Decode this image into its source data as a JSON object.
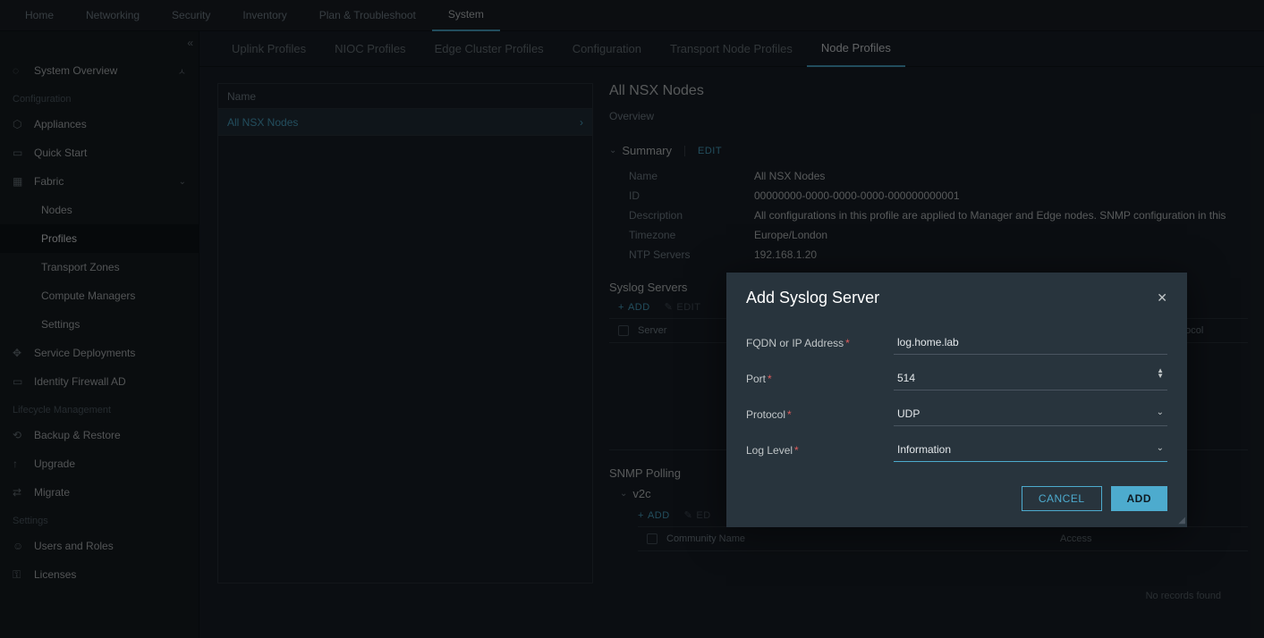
{
  "topnav": {
    "items": [
      "Home",
      "Networking",
      "Security",
      "Inventory",
      "Plan & Troubleshoot",
      "System"
    ],
    "active": 5
  },
  "sidebar": {
    "overview_label": "System Overview",
    "groups": {
      "configuration": "Configuration",
      "lifecycle": "Lifecycle Management",
      "settings": "Settings"
    },
    "items": {
      "appliances": "Appliances",
      "quickstart": "Quick Start",
      "fabric": "Fabric",
      "nodes": "Nodes",
      "profiles": "Profiles",
      "tzones": "Transport Zones",
      "cmanagers": "Compute Managers",
      "fsettings": "Settings",
      "svcdeploy": "Service Deployments",
      "idfirewall": "Identity Firewall AD",
      "backup": "Backup & Restore",
      "upgrade": "Upgrade",
      "migrate": "Migrate",
      "usersroles": "Users and Roles",
      "licenses": "Licenses"
    }
  },
  "subtabs": {
    "items": [
      "Uplink Profiles",
      "NIOC Profiles",
      "Edge Cluster Profiles",
      "Configuration",
      "Transport Node Profiles",
      "Node Profiles"
    ],
    "active": 5
  },
  "list": {
    "header": "Name",
    "row0": "All NSX Nodes"
  },
  "details": {
    "title": "All NSX Nodes",
    "overview": "Overview",
    "summary_label": "Summary",
    "edit_label": "EDIT",
    "fields": {
      "name_k": "Name",
      "name_v": "All NSX Nodes",
      "id_k": "ID",
      "id_v": "00000000-0000-0000-0000-000000000001",
      "desc_k": "Description",
      "desc_v": "All configurations in this profile are applied to Manager and Edge nodes. SNMP configuration in this",
      "tz_k": "Timezone",
      "tz_v": "Europe/London",
      "ntp_k": "NTP Servers",
      "ntp_v": "192.168.1.20"
    },
    "syslog_title": "Syslog Servers",
    "add_label": "ADD",
    "edit_action": "EDIT",
    "server_col": "Server",
    "protocol_col": "Protocol",
    "snmp_title": "SNMP Polling",
    "v2c_label": "v2c",
    "community_col": "Community Name",
    "access_col": "Access",
    "norecords": "No records found"
  },
  "modal": {
    "title": "Add Syslog Server",
    "fqdn_label": "FQDN or IP Address",
    "fqdn_value": "log.home.lab",
    "port_label": "Port",
    "port_value": "514",
    "protocol_label": "Protocol",
    "protocol_value": "UDP",
    "loglevel_label": "Log Level",
    "loglevel_value": "Information",
    "cancel": "CANCEL",
    "add": "ADD"
  }
}
